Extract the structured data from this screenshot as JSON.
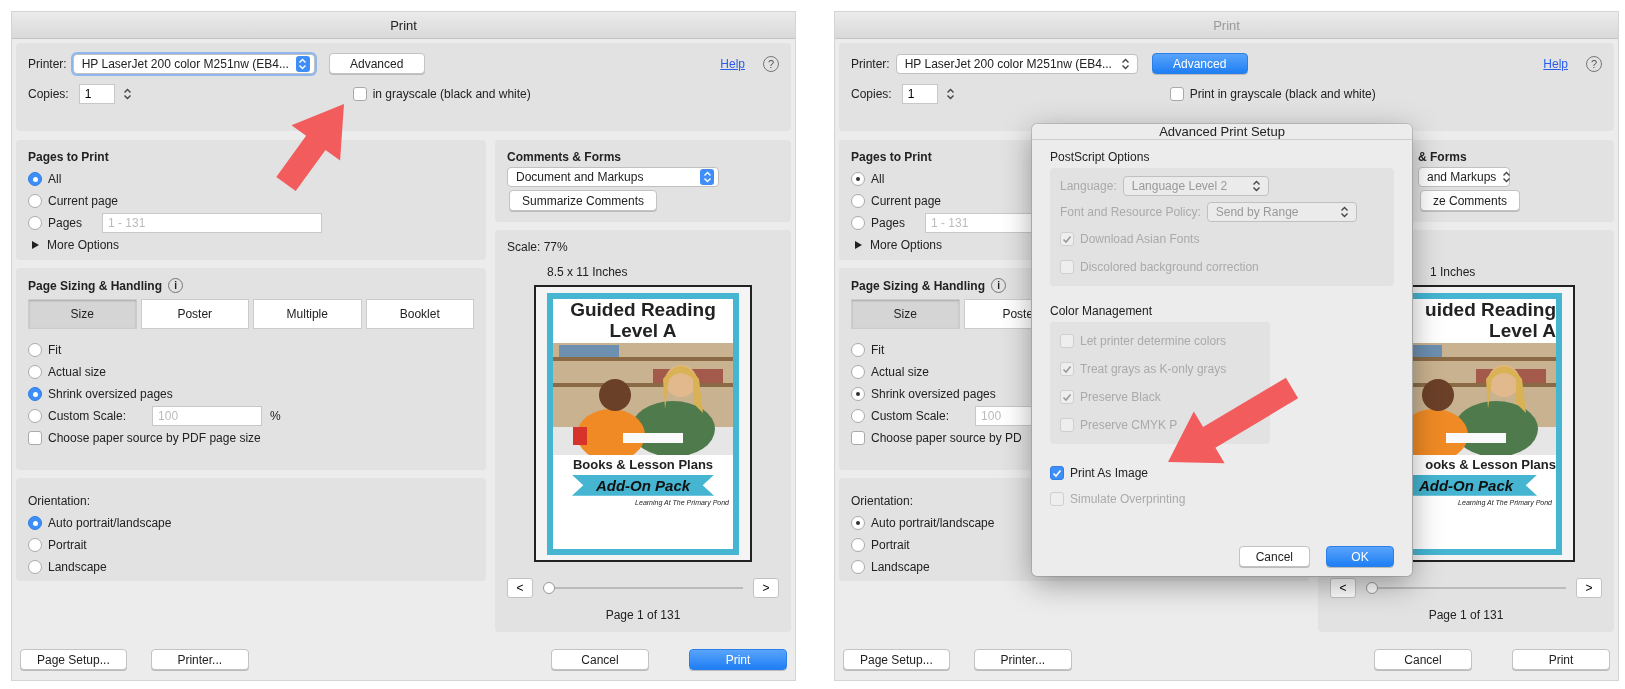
{
  "dialogs": [
    {
      "title": "Print",
      "active": true,
      "printer": {
        "label": "Printer:",
        "value": "HP LaserJet 200 color M251nw (EB4..."
      },
      "advanced_button": {
        "label": "Advanced",
        "primary": false
      },
      "help": {
        "label": "Help",
        "icon": "?"
      },
      "copies": {
        "label": "Copies:",
        "value": "1"
      },
      "grayscale": {
        "label": "in grayscale (black and white)",
        "checked": false
      },
      "pages_to_print": {
        "title": "Pages to Print",
        "options": [
          {
            "label": "All",
            "selected": true
          },
          {
            "label": "Current page",
            "selected": false
          },
          {
            "label": "Pages",
            "selected": false,
            "placeholder": "1 - 131"
          }
        ],
        "more_options": {
          "label": "More Options",
          "expanded": false
        }
      },
      "page_sizing": {
        "title": "Page Sizing & Handling",
        "info_icon": "i",
        "tabs": [
          {
            "label": "Size",
            "selected": true
          },
          {
            "label": "Poster",
            "selected": false
          },
          {
            "label": "Multiple",
            "selected": false
          },
          {
            "label": "Booklet",
            "selected": false
          }
        ],
        "options": [
          {
            "label": "Fit",
            "selected": false
          },
          {
            "label": "Actual size",
            "selected": false
          },
          {
            "label": "Shrink oversized pages",
            "selected": true
          },
          {
            "label": "Custom Scale:",
            "selected": false,
            "placeholder": "100",
            "suffix": "%"
          }
        ],
        "paper_source": {
          "label": "Choose paper source by PDF page size",
          "checked": false
        }
      },
      "orientation": {
        "title": "Orientation:",
        "options": [
          {
            "label": "Auto portrait/landscape",
            "selected": true
          },
          {
            "label": "Portrait",
            "selected": false
          },
          {
            "label": "Landscape",
            "selected": false
          }
        ]
      },
      "comments": {
        "title": "Comments & Forms",
        "dropdown": "Document and Markups",
        "button": "Summarize Comments"
      },
      "preview": {
        "scale": "Scale:  77%",
        "paper_size": "8.5 x 11 Inches",
        "cover": {
          "lines": [
            "Guided Reading",
            "Level A"
          ],
          "subtitle": "Books & Lesson Plans",
          "banner": "Add-On Pack",
          "footer": "Learning At The Primary Pond"
        },
        "prev": "<",
        "next": ">",
        "slider": {
          "level": 0
        },
        "page_label": "Page 1 of 131"
      },
      "footer": {
        "left": [
          "Page Setup...",
          "Printer..."
        ],
        "right": [
          {
            "label": "Cancel",
            "primary": false
          },
          {
            "label": "Print",
            "primary": true
          }
        ]
      }
    },
    {
      "title": "Print",
      "active": false,
      "printer": {
        "label": "Printer:",
        "value": "HP LaserJet 200 color M251nw (EB4..."
      },
      "advanced_button": {
        "label": "Advanced",
        "primary": true
      },
      "help": {
        "label": "Help",
        "icon": "?"
      },
      "copies": {
        "label": "Copies:",
        "value": "1"
      },
      "grayscale": {
        "label": "Print in grayscale (black and white)",
        "checked": false
      },
      "pages_to_print": {
        "title": "Pages to Print",
        "options": [
          {
            "label": "All",
            "selected": true
          },
          {
            "label": "Current page",
            "selected": false
          },
          {
            "label": "Pages",
            "selected": false,
            "placeholder": "1 - 131"
          }
        ],
        "more_options": {
          "label": "More Options",
          "expanded": false
        }
      },
      "page_sizing": {
        "title": "Page Sizing & Handling",
        "info_icon": "i",
        "tabs": [
          {
            "label": "Size",
            "selected": true
          },
          {
            "label": "Poste",
            "selected": false
          }
        ],
        "options": [
          {
            "label": "Fit",
            "selected": false
          },
          {
            "label": "Actual size",
            "selected": false
          },
          {
            "label": "Shrink oversized pages",
            "selected": true
          },
          {
            "label": "Custom Scale:",
            "selected": false,
            "placeholder": "100"
          }
        ],
        "paper_source": {
          "label": "Choose paper source by PD",
          "checked": false
        }
      },
      "orientation": {
        "title": "Orientation:",
        "options": [
          {
            "label": "Auto portrait/landscape",
            "selected": true
          },
          {
            "label": "Portrait",
            "selected": false
          },
          {
            "label": "Landscape",
            "selected": false
          }
        ]
      },
      "comments": {
        "title": "& Forms",
        "dropdown": "and Markups",
        "button": "ze Comments"
      },
      "preview": {
        "paper_size": "1 Inches",
        "cover": {
          "lines": [
            "uided Reading",
            "Level A"
          ],
          "subtitle": "ooks & Lesson Plans",
          "banner": "Add-On Pack",
          "footer": "Learning At The Primary Pond"
        },
        "prev": "<",
        "next": ">",
        "slider": {
          "level": 0
        },
        "page_label": "Page 1 of 131"
      },
      "footer": {
        "left": [
          "Page Setup...",
          "Printer..."
        ],
        "right": [
          {
            "label": "Cancel",
            "primary": false
          },
          {
            "label": "Print",
            "primary": false
          }
        ]
      },
      "advanced_setup": {
        "title": "Advanced Print Setup",
        "postscript": {
          "title": "PostScript Options",
          "language": {
            "label": "Language:",
            "value": "Language Level 2"
          },
          "font_policy": {
            "label": "Font and Resource Policy:",
            "value": "Send by Range"
          },
          "checks": [
            {
              "label": "Download Asian Fonts",
              "checked": true,
              "disabled": true
            },
            {
              "label": "Discolored background correction",
              "checked": false,
              "disabled": true
            }
          ]
        },
        "color_management": {
          "title": "Color Management",
          "checks": [
            {
              "label": "Let printer determine colors",
              "checked": false,
              "disabled": true
            },
            {
              "label": "Treat grays as K-only grays",
              "checked": true,
              "disabled": true
            },
            {
              "label": "Preserve Black",
              "checked": true,
              "disabled": true
            },
            {
              "label": "Preserve CMYK P",
              "checked": false,
              "disabled": true
            }
          ]
        },
        "checks": [
          {
            "label": "Print As Image",
            "checked": true,
            "disabled": false
          },
          {
            "label": "Simulate Overprinting",
            "checked": false,
            "disabled": true
          }
        ],
        "buttons": [
          {
            "label": "Cancel",
            "primary": false
          },
          {
            "label": "OK",
            "primary": true
          }
        ]
      }
    }
  ]
}
